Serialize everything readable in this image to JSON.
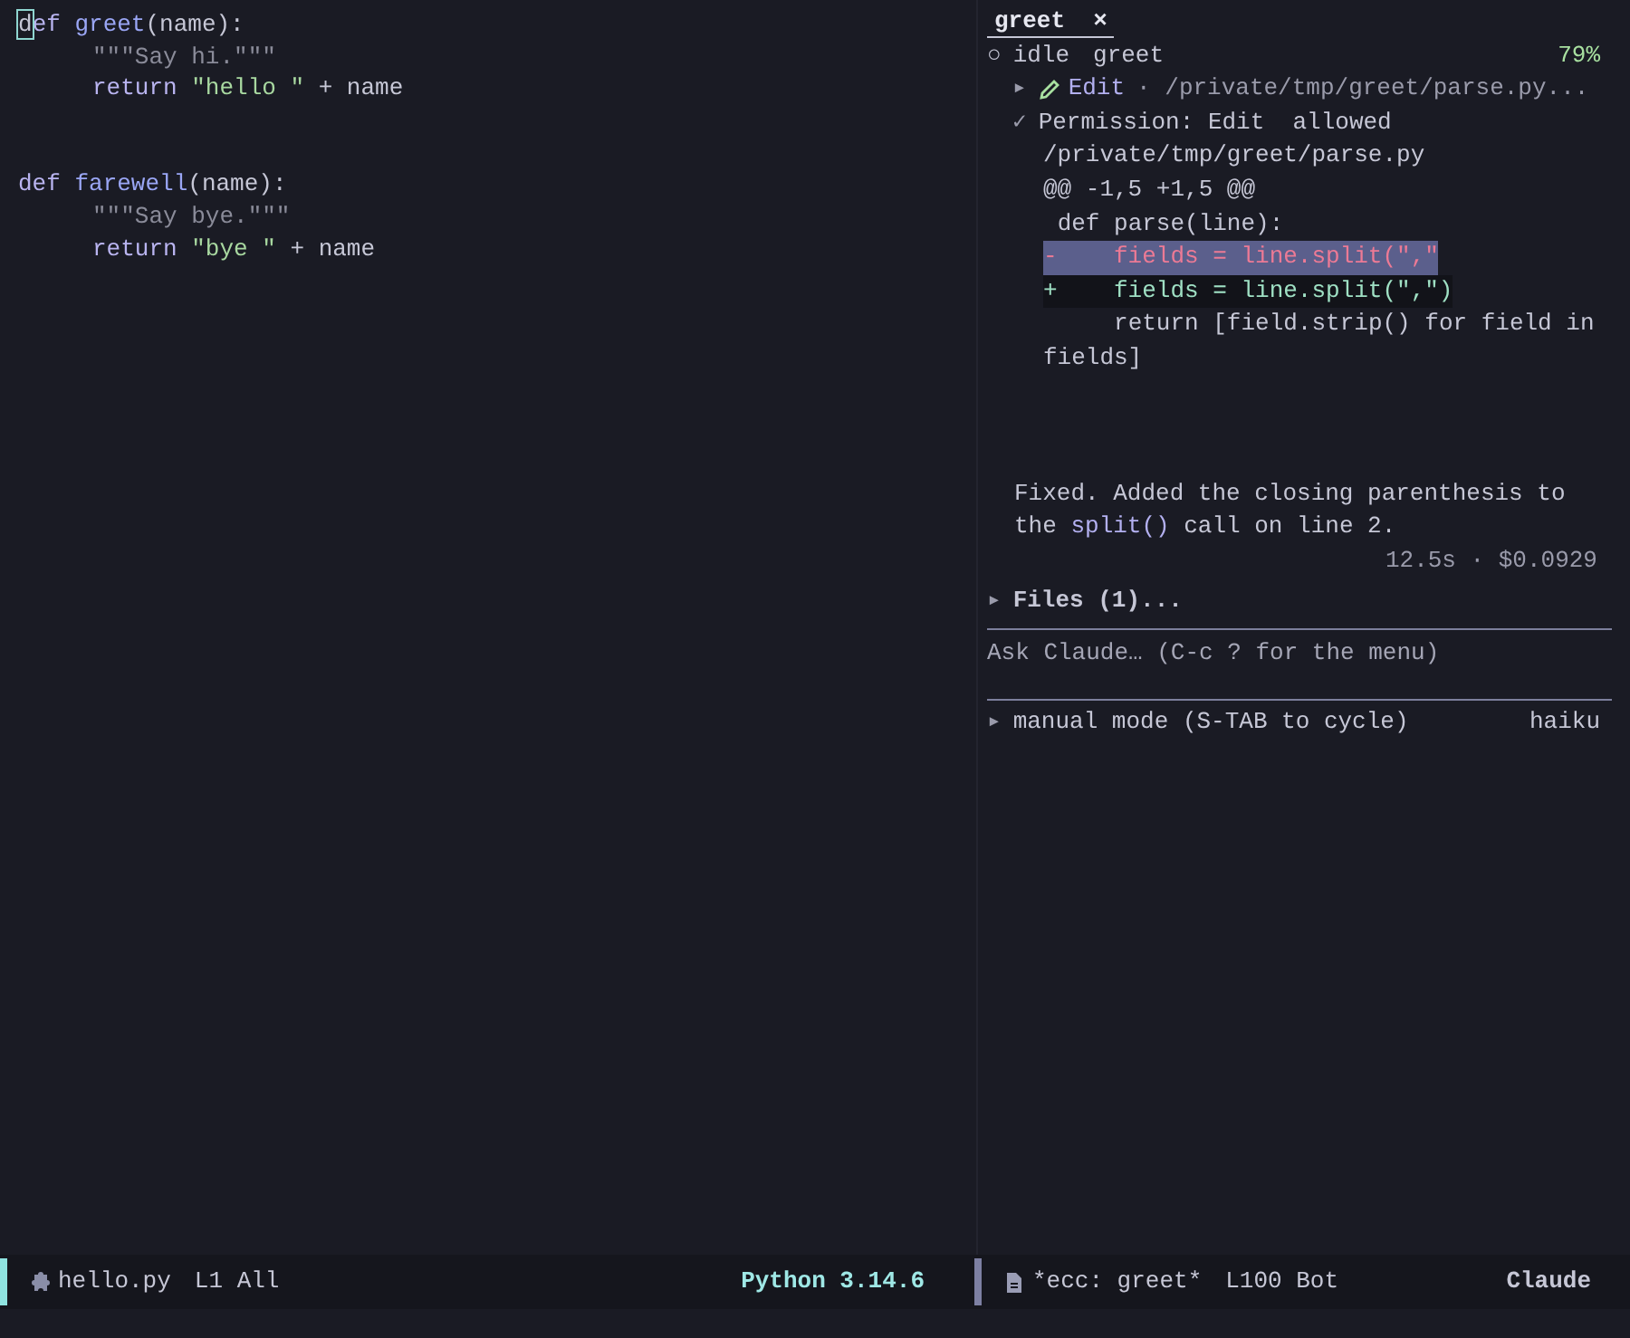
{
  "editor": {
    "lines": [
      {
        "kind": "code",
        "indented": false,
        "tokens": [
          {
            "kind": "cursor",
            "text": "d"
          },
          {
            "kind": "keyword",
            "text": "ef "
          },
          {
            "kind": "func",
            "text": "greet"
          },
          {
            "kind": "plain",
            "text": "(name):"
          }
        ]
      },
      {
        "kind": "code",
        "indented": true,
        "tokens": [
          {
            "kind": "doc",
            "text": "\"\"\"Say hi.\"\"\""
          }
        ]
      },
      {
        "kind": "code",
        "indented": true,
        "tokens": [
          {
            "kind": "keyword",
            "text": "return "
          },
          {
            "kind": "string",
            "text": "\"hello \""
          },
          {
            "kind": "plain",
            "text": " + name"
          }
        ]
      },
      {
        "kind": "blank"
      },
      {
        "kind": "blank"
      },
      {
        "kind": "code",
        "indented": false,
        "tokens": [
          {
            "kind": "keyword",
            "text": "def "
          },
          {
            "kind": "func",
            "text": "farewell"
          },
          {
            "kind": "plain",
            "text": "(name):"
          }
        ]
      },
      {
        "kind": "code",
        "indented": true,
        "tokens": [
          {
            "kind": "doc",
            "text": "\"\"\"Say bye.\"\"\""
          }
        ]
      },
      {
        "kind": "code",
        "indented": true,
        "tokens": [
          {
            "kind": "keyword",
            "text": "return "
          },
          {
            "kind": "string",
            "text": "\"bye \""
          },
          {
            "kind": "plain",
            "text": " + name"
          }
        ]
      }
    ]
  },
  "session": {
    "tab": {
      "label": "greet",
      "close": "×",
      "selected": true
    },
    "status": {
      "marker": "○",
      "state": "idle",
      "name": "greet",
      "percent": "79%"
    },
    "tool": {
      "expander": "▸",
      "tool": "Edit",
      "detail": "· /private/tmp/greet/parse.py..."
    },
    "permission": {
      "mark": "✓",
      "label": "Permission: Edit  allowed",
      "path": "/private/tmp/greet/parse.py"
    },
    "diff": [
      {
        "kind": "hunk",
        "text": "@@ -1,5 +1,5 @@"
      },
      {
        "kind": "context",
        "text": " def parse(line):"
      },
      {
        "kind": "removed",
        "text": "-    fields = line.split(\",\""
      },
      {
        "kind": "added",
        "text": "+    fields = line.split(\",\")"
      },
      {
        "kind": "context",
        "text": "     return [field.strip() for field in fields]"
      }
    ],
    "message": [
      {
        "kind": "text",
        "text": "Fixed. Added the closing parenthesis to the "
      },
      {
        "kind": "code",
        "text": "split()"
      },
      {
        "kind": "text",
        "text": " call on line 2."
      }
    ],
    "timing": "12.5s · $0.0929",
    "files": {
      "expander": "▸",
      "label": "Files (1)..."
    },
    "prompt": {
      "placeholder": "Ask Claude… (C-c ? for the menu)"
    },
    "mode": {
      "expander": "▸",
      "label": "manual mode (S-TAB to cycle)",
      "model": "haiku"
    }
  },
  "mode_lines": [
    {
      "kind": "code",
      "buffer": "hello.py",
      "position": "L1 All",
      "language": "Python 3.14.6",
      "active": true
    },
    {
      "kind": "chat",
      "buffer": "*ecc: greet*",
      "position": "L100 Bot",
      "language": "Claude",
      "active": false
    }
  ]
}
